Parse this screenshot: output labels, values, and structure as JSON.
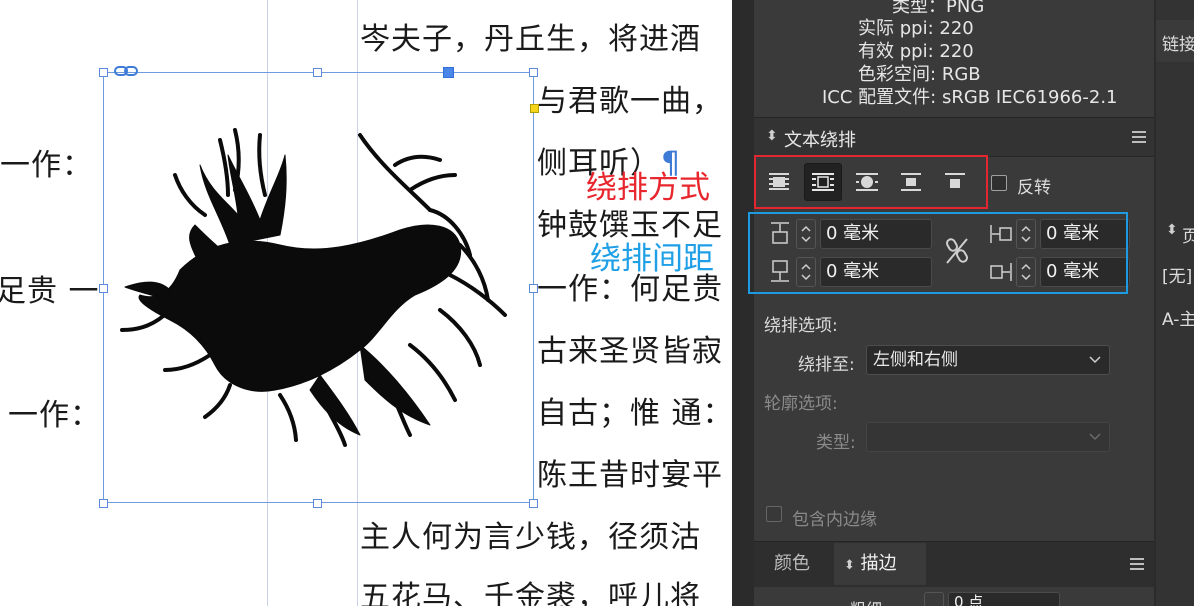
{
  "document": {
    "lines_right": [
      "岑夫子，丹丘生，将进酒",
      "与君歌一曲，",
      "侧耳听）",
      "钟鼓馔玉不足",
      "一作：何足贵",
      "古来圣贤皆寂",
      "自古；惟 通：",
      "陈王昔时宴平",
      "主人何为言少钱，径须沽",
      "五花马、千金裘，呼儿将"
    ],
    "lines_left": [
      "一作：",
      "足贵 一",
      "一作："
    ],
    "pilcrow": "¶"
  },
  "annotations": {
    "wrap_mode": "绕排方式",
    "wrap_spacing": "绕排间距"
  },
  "info": {
    "type_label": "类型：",
    "type_value": "PNG",
    "actual_ppi_label": "实际 ppi:",
    "actual_ppi_value": "220",
    "effective_ppi_label": "有效 ppi:",
    "effective_ppi_value": "220",
    "color_space_label": "色彩空间:",
    "color_space_value": "RGB",
    "icc_label": "ICC 配置文件:",
    "icc_value": "sRGB IEC61966-2.1"
  },
  "text_wrap": {
    "panel_title": "文本绕排",
    "invert_label": "反转",
    "offsets": {
      "top": "0 毫米",
      "bottom": "0 毫米",
      "left": "0 毫米",
      "right": "0 毫米"
    },
    "wrap_options_label": "绕排选项:",
    "wrap_to_label": "绕排至:",
    "wrap_to_value": "左侧和右侧",
    "contour_options_label": "轮廓选项:",
    "contour_type_label": "类型:",
    "contour_type_value": "",
    "include_inside_edges_label": "包含内边缘"
  },
  "bottom_tabs": {
    "color": "颜色",
    "stroke": "描边",
    "weight_label": "粗细",
    "weight_value": "0 点"
  },
  "right_column": {
    "links_label": "链接",
    "pages_label": "页",
    "none_label": "[无]",
    "master_label": "A-主"
  },
  "colors": {
    "annotation_red": "#e3262f",
    "annotation_blue": "#1d9be0",
    "panel_bg": "#3a3a3a",
    "selection_frame": "#6f9bde"
  }
}
